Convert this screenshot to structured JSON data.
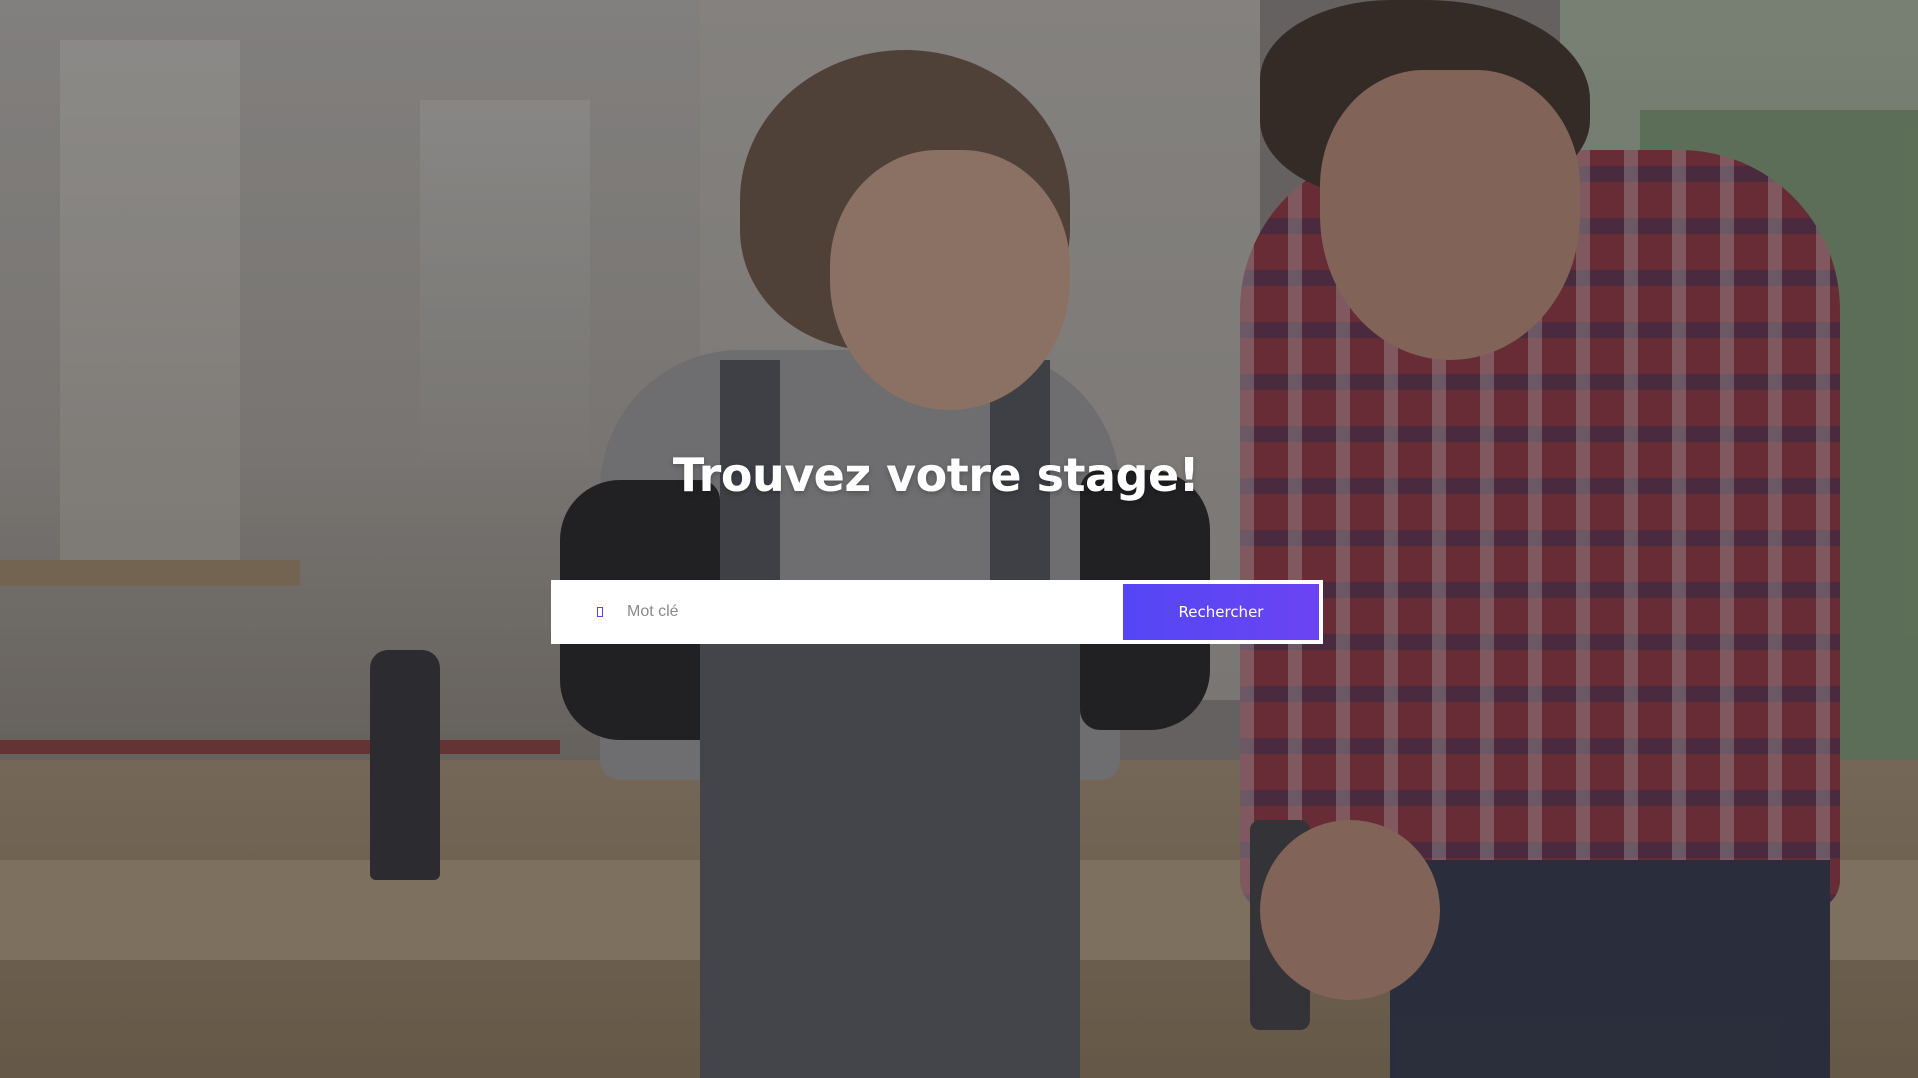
{
  "hero": {
    "headline": "Trouvez votre stage!"
  },
  "search": {
    "placeholder": "Mot clé",
    "value": "",
    "icon": "search-icon",
    "button_label": "Rechercher"
  },
  "colors": {
    "accent": "#5446f5",
    "accent_end": "#6b44f2",
    "overlay": "#28282d"
  }
}
